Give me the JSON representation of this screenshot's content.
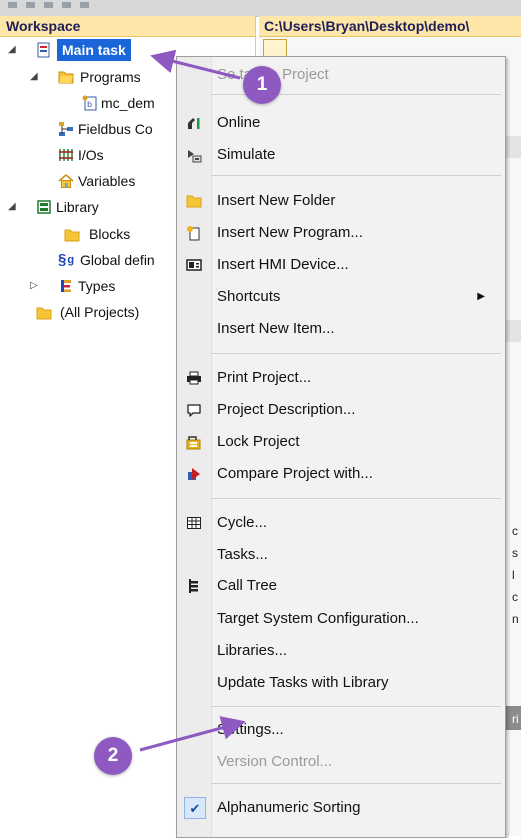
{
  "workspace": {
    "title": "Workspace",
    "tree": {
      "main_task": "Main task",
      "programs": "Programs",
      "mc_demo": "mc_dem",
      "fieldbus": "Fieldbus Co",
      "ios": "I/Os",
      "variables": "Variables",
      "library": "Library",
      "blocks": "Blocks",
      "global_defs": "Global defin",
      "types": "Types",
      "all_projects": "(All Projects)"
    }
  },
  "path_bar": {
    "text": "C:\\Users\\Bryan\\Desktop\\demo\\"
  },
  "right_pane_fragments": [
    "c",
    "s",
    "l",
    "c",
    "n",
    "ri"
  ],
  "context_menu": {
    "items": [
      {
        "label": "Set as Startup Project",
        "shown": "Se   tartup Project",
        "disabled": true,
        "icon": "none"
      },
      {
        "label": "Online",
        "disabled": false,
        "icon": "online-icon"
      },
      {
        "label": "Simulate",
        "disabled": false,
        "icon": "simulate-icon"
      },
      {
        "label": "Insert New Folder",
        "disabled": false,
        "icon": "folder-icon"
      },
      {
        "label": "Insert New Program...",
        "disabled": false,
        "icon": "new-program-icon"
      },
      {
        "label": "Insert HMI Device...",
        "disabled": false,
        "icon": "hmi-icon"
      },
      {
        "label": "Shortcuts",
        "disabled": false,
        "icon": "none",
        "submenu": true
      },
      {
        "label": "Insert New Item...",
        "disabled": false,
        "icon": "none"
      },
      {
        "label": "Print Project...",
        "disabled": false,
        "icon": "print-icon"
      },
      {
        "label": "Project Description...",
        "disabled": false,
        "icon": "comment-icon"
      },
      {
        "label": "Lock Project",
        "disabled": false,
        "icon": "lock-icon"
      },
      {
        "label": "Compare Project with...",
        "disabled": false,
        "icon": "compare-icon"
      },
      {
        "label": "Cycle...",
        "disabled": false,
        "icon": "cycle-icon"
      },
      {
        "label": "Tasks...",
        "disabled": false,
        "icon": "none"
      },
      {
        "label": "Call Tree",
        "disabled": false,
        "icon": "call-tree-icon"
      },
      {
        "label": "Target System Configuration...",
        "disabled": false,
        "icon": "none"
      },
      {
        "label": "Libraries...",
        "disabled": false,
        "icon": "none"
      },
      {
        "label": "Update Tasks with Library",
        "disabled": false,
        "icon": "none"
      },
      {
        "label": "Settings...",
        "disabled": false,
        "icon": "none"
      },
      {
        "label": "Version Control...",
        "disabled": true,
        "icon": "none"
      },
      {
        "label": "Alphanumeric Sorting",
        "disabled": false,
        "icon": "checkmark-icon",
        "checked": true
      }
    ]
  },
  "callouts": {
    "one": "1",
    "two": "2"
  },
  "colors": {
    "selection": "#1a66d9",
    "header_bg": "#fde6a8",
    "callout": "#8e5ac2",
    "menu_bg": "#f2f2f2"
  }
}
